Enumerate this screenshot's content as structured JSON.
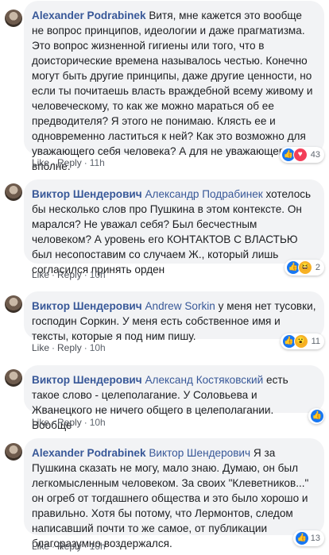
{
  "comments": [
    {
      "author": "Alexander Podrabinek",
      "mention": "",
      "text": "Витя, мне кажется это вообще не вопрос принципов, идеологии и даже прагматизма. Это вопрос жизненной гигиены или того, что в доисторические времена называлось честью. Конечно могут быть другие принципы, даже другие ценности, но если ты почитаешь власть враждебной всему живому и человеческому, то как же можно мараться об ее предводителя? Я этого не понимаю. Клясть ее и одновременно ластиться к ней? Как это возможно для уважающего себя человека? А для не уважающего, да, вполне.",
      "like": "Like",
      "reply": "Reply",
      "time": "11h",
      "reactions": [
        "like-icon",
        "love-icon"
      ],
      "reaction_count": "43"
    },
    {
      "author": "Виктор Шендерович",
      "mention": "Александр Подрабинек",
      "text": "хотелось бы несколько слов про Пушкина в этом контексте. Он марался? Не уважал себя? Был бесчестным человеком? А уровень его КОНТАКТОВ С ВЛАСТЬЮ был несопоставим со случаем Ж., который лишь согласился принять орден",
      "like": "Like",
      "reply": "Reply",
      "time": "10h",
      "reactions": [
        "like-icon",
        "haha-icon"
      ],
      "reaction_count": "2"
    },
    {
      "author": "Виктор Шендерович",
      "mention": "Andrew Sorkin",
      "text": "у меня нет тусовки, господин Соркин. У меня есть собственное имя и тексты, которые я под ним пишу.",
      "like": "Like",
      "reply": "Reply",
      "time": "10h",
      "reactions": [
        "like-icon",
        "wow-icon"
      ],
      "reaction_count": "11"
    },
    {
      "author": "Виктор Шендерович",
      "mention": "Александ Костяковский",
      "text": "есть такое слово - целеполагание. У Соловьева и Жванецкого не ничего общего в целеполагании. Вообще",
      "like": "Like",
      "reply": "Reply",
      "time": "10h",
      "reactions": [
        "like-icon"
      ],
      "reaction_count": ""
    },
    {
      "author": "Alexander Podrabinek",
      "mention": "Виктор Шендерович",
      "text": "Я за Пушкина сказать не могу, мало знаю. Думаю, он был легкомысленным человеком. За своих \"Клеветников...\" он огреб от тогдашнего общества и это было хорошо и правильно. Хотя бы потому, что Лермонтов, следом написавший почти то же самое, от публикации благоразумно воздержался.",
      "like": "Like",
      "reply": "Reply",
      "time": "10h",
      "reactions": [
        "like-icon"
      ],
      "reaction_count": "13"
    }
  ],
  "colors": {
    "author": "#385898",
    "bubble": "#f2f3f5",
    "like_reaction": "#1877f2",
    "love_reaction": "#f33e58",
    "emoji_reaction": "#f7b125"
  }
}
